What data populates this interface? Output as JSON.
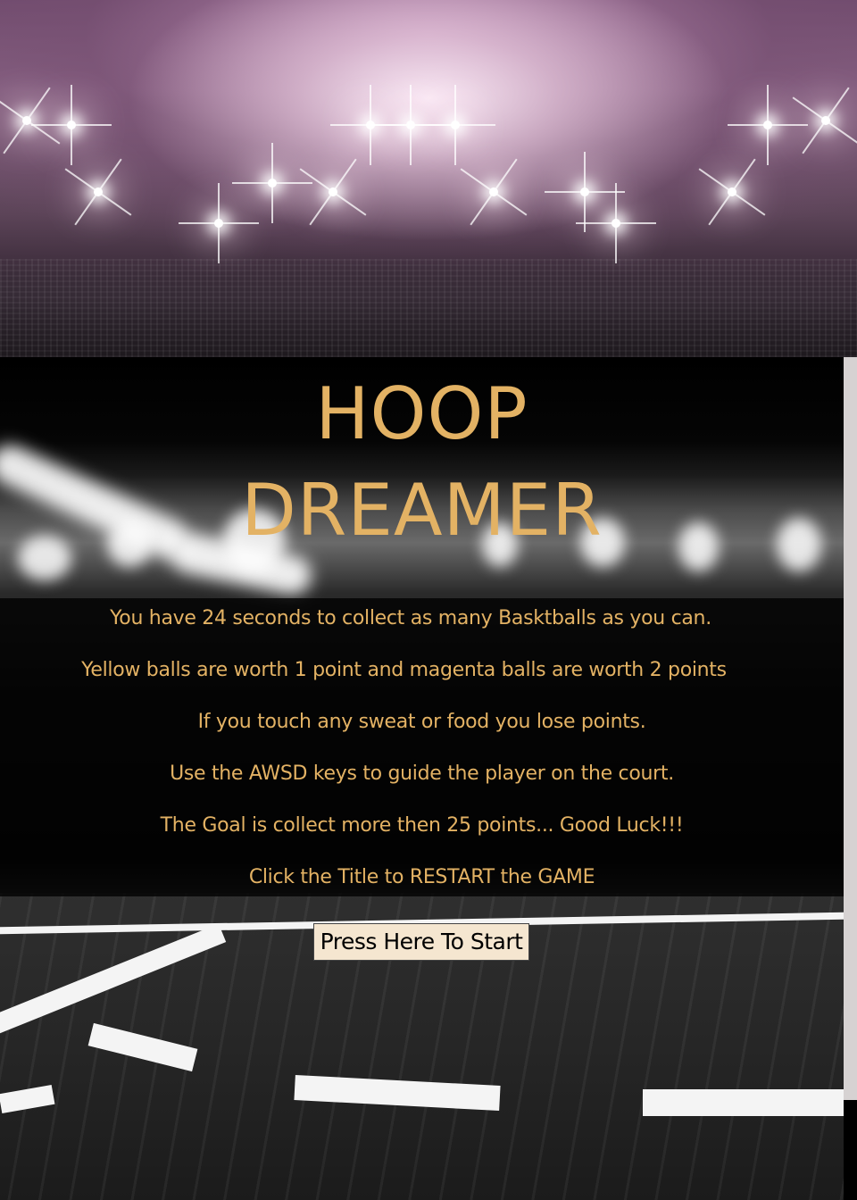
{
  "title": {
    "line1": "HOOP",
    "line2": "DREAMER"
  },
  "instructions": [
    "You have 24 seconds to collect as many Basktballs as you can.",
    "Yellow balls are worth 1 point and magenta balls are worth 2 points",
    "If you touch any sweat or food you lose points.",
    "Use the AWSD keys to guide the player on the court.",
    "The Goal is collect more then 25 points... Good Luck!!!",
    "Click the Title to RESTART the GAME"
  ],
  "start_button": {
    "label": "Press Here To Start"
  },
  "colors": {
    "accent_gold": "#e3b264",
    "button_background": "#f5e6d0",
    "panel_background": "#000000"
  }
}
